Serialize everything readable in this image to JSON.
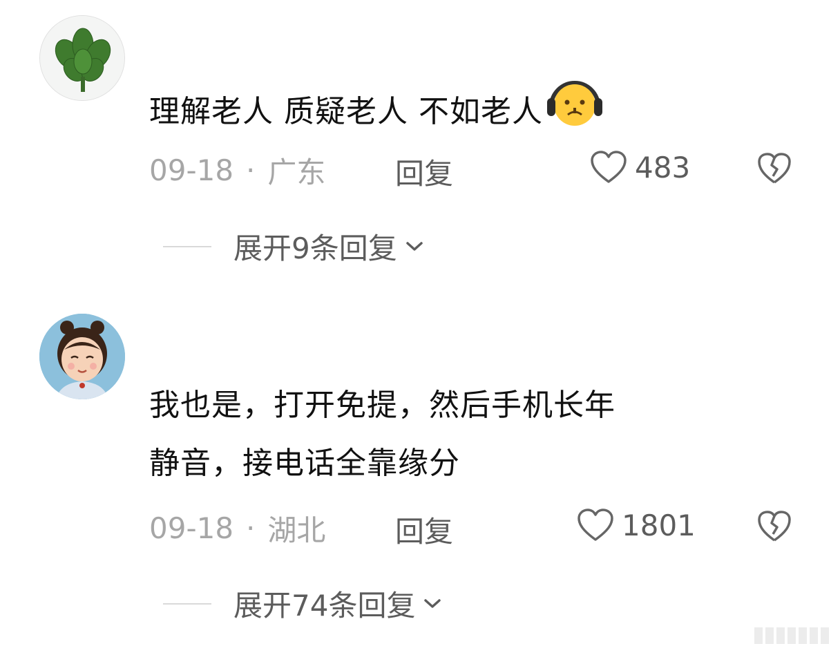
{
  "comments": [
    {
      "avatar_icon": "plant-leaves-avatar",
      "text_lines": [
        "理解老人 质疑老人 不如老人"
      ],
      "emoji_icon": "headphones-grumpy-face-emoji",
      "date": "09-18",
      "location": "广东",
      "reply_label": "回复",
      "likes": "483",
      "expand_label": "展开9条回复"
    },
    {
      "avatar_icon": "cartoon-girl-avatar",
      "text_lines": [
        "我也是，打开免提，然后手机长年",
        "静音，接电话全靠缘分"
      ],
      "date": "09-18",
      "location": "湖北",
      "reply_label": "回复",
      "likes": "1801",
      "expand_label": "展开74条回复"
    }
  ],
  "colors": {
    "meta_gray": "#a6a6a6",
    "action_gray": "#5c5c5c",
    "text": "#111111"
  }
}
